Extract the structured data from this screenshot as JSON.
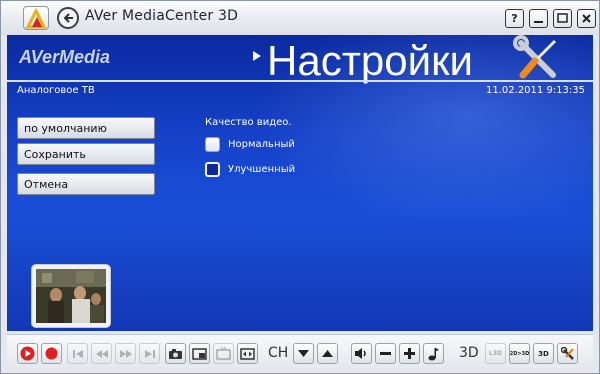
{
  "window": {
    "title": "AVer MediaCenter 3D"
  },
  "header": {
    "brand": "AVerMedia",
    "page_title": "Настройки",
    "mode": "Аналоговое ТВ",
    "datetime": "11.02.2011 9:13:35"
  },
  "sidebar": {
    "buttons": [
      "по умолчанию",
      "Сохранить",
      "Отмена"
    ]
  },
  "settings": {
    "quality_label": "Качество видео.",
    "options": [
      {
        "label": "Нормальный",
        "selected": false
      },
      {
        "label": "Улучшенный",
        "selected": true
      }
    ]
  },
  "toolbar": {
    "ch_label": "CH",
    "threed_label": "3D",
    "small_labels": {
      "l3d": "L3D",
      "two_to_three": "2D>3D",
      "threed": "3D"
    }
  },
  "colors": {
    "panel_blue": "#1642c9",
    "record_red": "#e0201e",
    "highlight_white": "#ffffff"
  }
}
